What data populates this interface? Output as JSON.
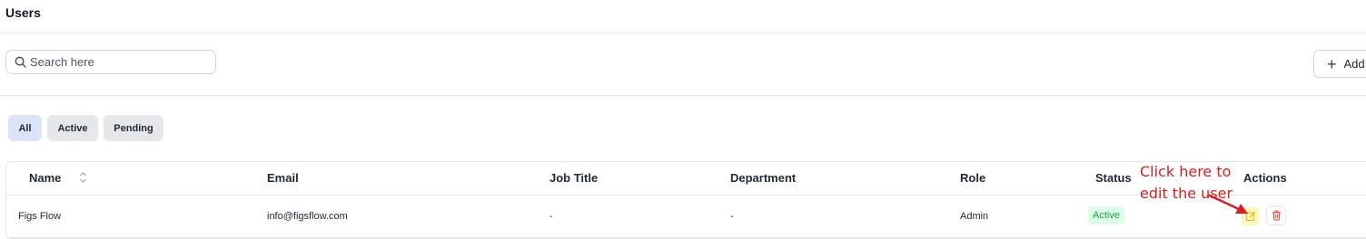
{
  "header": {
    "title": "Users"
  },
  "search": {
    "placeholder": "Search here",
    "value": ""
  },
  "toolbar": {
    "add_label": "Add"
  },
  "filters": [
    {
      "label": "All",
      "selected": true
    },
    {
      "label": "Active",
      "selected": false
    },
    {
      "label": "Pending",
      "selected": false
    }
  ],
  "table": {
    "columns": [
      "Name",
      "Email",
      "Job Title",
      "Department",
      "Role",
      "Status",
      "Actions"
    ],
    "rows": [
      {
        "name": "Figs Flow",
        "email": "info@figsflow.com",
        "job_title": "-",
        "department": "-",
        "role": "Admin",
        "status": "Active"
      }
    ]
  },
  "annotation": {
    "text": "Click here to edit the user",
    "color": "#d42020"
  },
  "colors": {
    "selected_chip": "#dbe5f7",
    "status_active_bg": "#dcfce7",
    "status_active_text": "#16a34a",
    "delete_icon": "#ef4444",
    "edit_icon": "#eab308"
  },
  "icons": {
    "search": "search-icon",
    "add": "plus-icon",
    "sort": "sort-icon",
    "edit": "edit-icon",
    "delete": "trash-icon"
  }
}
